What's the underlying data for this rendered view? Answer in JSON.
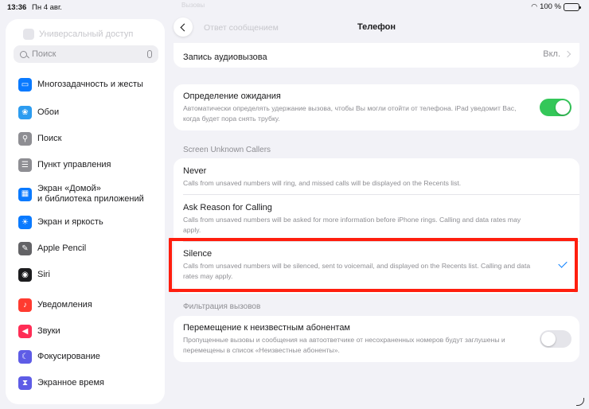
{
  "status": {
    "time": "13:36",
    "date": "Пн 4 авг.",
    "battery": "100 %"
  },
  "sidebar": {
    "faded_top": "Универсальный доступ",
    "search_placeholder": "Поиск",
    "items": [
      {
        "label": "Многозадачность и жесты",
        "icon": "multitasking-icon",
        "color": "#0a7aff"
      },
      {
        "label": "Обои",
        "icon": "wallpaper-icon",
        "color": "#2c9cf0"
      },
      {
        "label": "Поиск",
        "icon": "search-icon",
        "color": "#8e8e93"
      },
      {
        "label": "Пункт управления",
        "icon": "control-center-icon",
        "color": "#8e8e93"
      },
      {
        "label": "Экран «Домой»\nи библиотека приложений",
        "icon": "home-screen-icon",
        "color": "#0a7aff"
      },
      {
        "label": "Экран и яркость",
        "icon": "brightness-icon",
        "color": "#0a7aff"
      },
      {
        "label": "Apple Pencil",
        "icon": "pencil-icon",
        "color": "#636366"
      },
      {
        "label": "Siri",
        "icon": "siri-icon",
        "color": "#1c1c1e"
      },
      {
        "label": "Уведомления",
        "icon": "notifications-icon",
        "color": "#ff3b30"
      },
      {
        "label": "Звуки",
        "icon": "sounds-icon",
        "color": "#ff2d55"
      },
      {
        "label": "Фокусирование",
        "icon": "focus-icon",
        "color": "#5e5ce6"
      },
      {
        "label": "Экранное время",
        "icon": "screen-time-icon",
        "color": "#5e5ce6"
      }
    ]
  },
  "nav": {
    "title": "Телефон",
    "ghost_label": "Ответ сообщением",
    "ghost_top": "Вызовы"
  },
  "audio_row": {
    "title": "Запись аудиовызова",
    "value": "Вкл."
  },
  "hold": {
    "title": "Определение ожидания",
    "subtitle": "Автоматически определять удержание вызова, чтобы Вы могли отойти от телефона. iPad уведомит Вас, когда будет пора снять трубку.",
    "enabled": true
  },
  "screen_unknown": {
    "header": "Screen Unknown Callers",
    "options": [
      {
        "title": "Never",
        "subtitle": "Calls from unsaved numbers will ring, and missed calls will be displayed on the Recents list.",
        "selected": false
      },
      {
        "title": "Ask Reason for Calling",
        "subtitle": "Calls from unsaved numbers will be asked for more information before iPhone rings. Calling and data rates may apply.",
        "selected": false
      },
      {
        "title": "Silence",
        "subtitle": "Calls from unsaved numbers will be silenced, sent to voicemail, and displayed on the Recents list. Calling and data rates may apply.",
        "selected": true
      }
    ]
  },
  "filter": {
    "header": "Фильтрация вызовов",
    "title": "Перемещение к неизвестным абонентам",
    "subtitle": "Пропущенные вызовы и сообщения на автоответчике от несохраненных номеров будут заглушены и перемещены в список «Неизвестные абоненты».",
    "enabled": false
  },
  "colors": {
    "accent": "#007aff",
    "toggle_on": "#34c759",
    "highlight": "#ff1e0e"
  }
}
